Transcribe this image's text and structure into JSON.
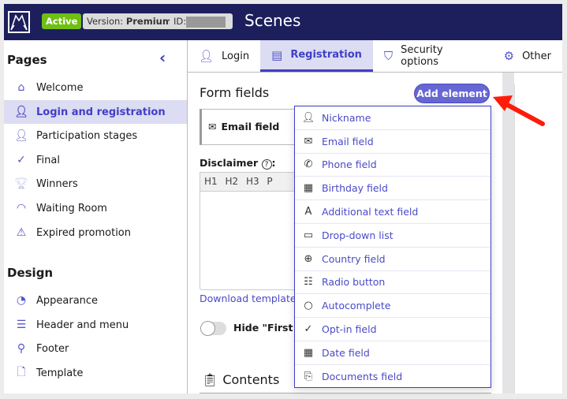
{
  "header": {
    "status": "Active",
    "version_label": "Version:",
    "version_value": "Premium",
    "id_label": "ID:",
    "title": "Scenes"
  },
  "sidebar": {
    "pages_title": "Pages",
    "pages": [
      {
        "label": "Welcome",
        "icon": "home-icon"
      },
      {
        "label": "Login and registration",
        "icon": "user-icon",
        "active": true
      },
      {
        "label": "Participation stages",
        "icon": "user-stages-icon"
      },
      {
        "label": "Final",
        "icon": "check-icon"
      },
      {
        "label": "Winners",
        "icon": "trophy-icon"
      },
      {
        "label": "Waiting Room",
        "icon": "gauge-icon"
      },
      {
        "label": "Expired promotion",
        "icon": "warning-icon"
      }
    ],
    "design_title": "Design",
    "design": [
      {
        "label": "Appearance",
        "icon": "palette-icon"
      },
      {
        "label": "Header and menu",
        "icon": "menu-icon"
      },
      {
        "label": "Footer",
        "icon": "footer-icon"
      },
      {
        "label": "Template",
        "icon": "file-icon"
      }
    ]
  },
  "tabs": [
    {
      "label": "Login",
      "icon": "user-icon"
    },
    {
      "label": "Registration",
      "icon": "calendar-icon",
      "active": true
    },
    {
      "label": "Security options",
      "icon": "shield-icon"
    },
    {
      "label": "Other",
      "icon": "gear-icon"
    }
  ],
  "main": {
    "form_fields_title": "Form fields",
    "add_element": "Add element",
    "email_field": "Email field",
    "disclaimer": "Disclaimer",
    "disclaimer_suffix": ":",
    "editor_tools": "H1 H2 H3 P",
    "download_template": "Download template",
    "hide_toggle_label": "Hide \"First n",
    "contents_title": "Contents"
  },
  "dropdown": [
    {
      "label": "Nickname",
      "icon": "user-icon"
    },
    {
      "label": "Email field",
      "icon": "envelope-icon"
    },
    {
      "label": "Phone field",
      "icon": "phone-icon"
    },
    {
      "label": "Birthday field",
      "icon": "calendar-icon"
    },
    {
      "label": "Additional text field",
      "icon": "text-icon"
    },
    {
      "label": "Drop-down list",
      "icon": "dropdown-icon"
    },
    {
      "label": "Country field",
      "icon": "globe-icon"
    },
    {
      "label": "Radio button",
      "icon": "radio-list-icon"
    },
    {
      "label": "Autocomplete",
      "icon": "autocomplete-icon"
    },
    {
      "label": "Opt-in field",
      "icon": "check-icon"
    },
    {
      "label": "Date field",
      "icon": "calendar-icon"
    },
    {
      "label": "Documents field",
      "icon": "paperclip-icon"
    }
  ],
  "colors": {
    "header": "#1c1f5c",
    "accent": "#3f3fc8",
    "active": "#6fbf14",
    "arrow": "#ff1a0a"
  }
}
